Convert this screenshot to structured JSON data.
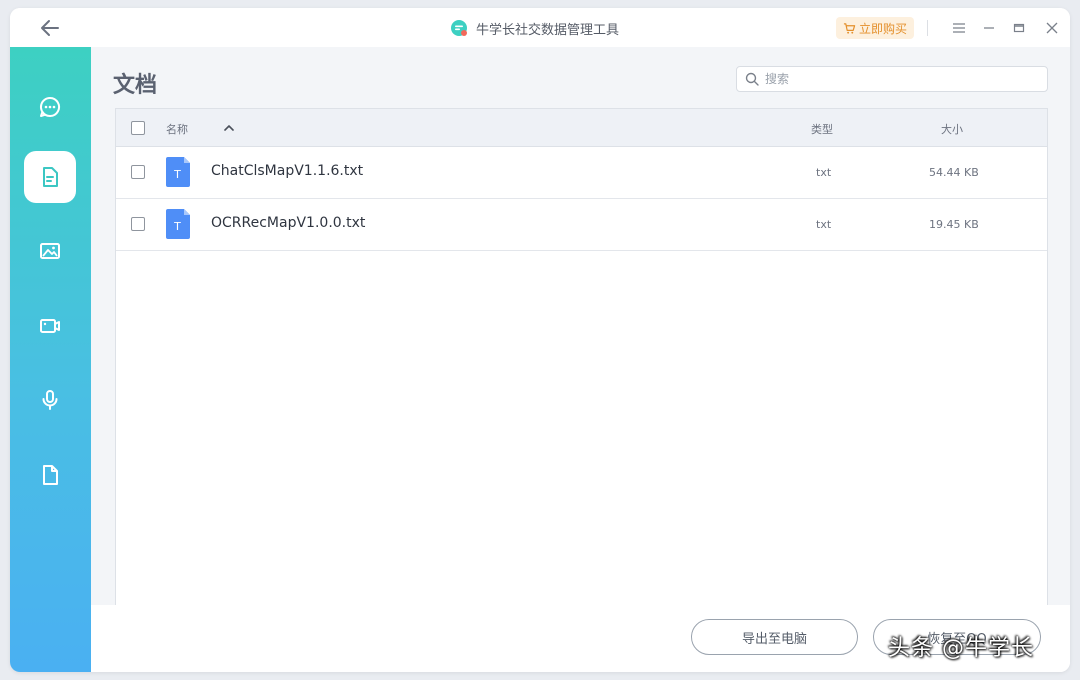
{
  "app": {
    "title": "牛学长社交数据管理工具",
    "buy_label": "立即购买",
    "accent": "#3dd0c2",
    "buy_color": "#e4902c"
  },
  "sidebar": {
    "items": [
      {
        "icon": "chat-bubble-icon",
        "active": false
      },
      {
        "icon": "document-icon",
        "active": true
      },
      {
        "icon": "image-icon",
        "active": false
      },
      {
        "icon": "video-camera-icon",
        "active": false
      },
      {
        "icon": "microphone-icon",
        "active": false
      },
      {
        "icon": "file-icon",
        "active": false
      }
    ]
  },
  "main": {
    "page_title": "文档",
    "search_placeholder": "搜索",
    "table": {
      "columns": {
        "name": "名称",
        "type": "类型",
        "size": "大小"
      },
      "rows": [
        {
          "name": "ChatClsMapV1.1.6.txt",
          "type": "txt",
          "size": "54.44 KB",
          "icon_letter": "T"
        },
        {
          "name": "OCRRecMapV1.0.0.txt",
          "type": "txt",
          "size": "19.45 KB",
          "icon_letter": "T"
        }
      ]
    }
  },
  "footer": {
    "export_label": "导出至电脑",
    "restore_label": "恢复至QQ"
  },
  "watermark": "头条 @牛学长"
}
